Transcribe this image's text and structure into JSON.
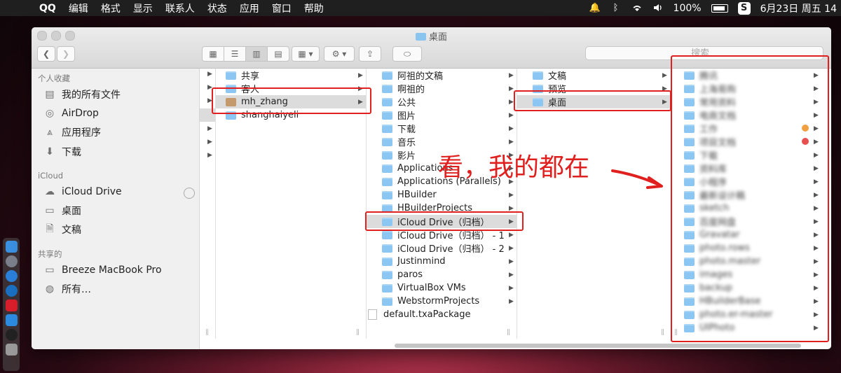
{
  "menubar": {
    "app_name": "QQ",
    "menus": [
      "编辑",
      "格式",
      "显示",
      "联系人",
      "状态",
      "应用",
      "窗口",
      "帮助"
    ],
    "battery": "100%",
    "datetime": "6月23日 周五  14",
    "status_icons": [
      "bell-icon",
      "bluetooth-icon",
      "wifi-icon",
      "volume-icon",
      "battery-icon",
      "sogou-input-icon"
    ]
  },
  "window": {
    "title": "桌面",
    "search_placeholder": "搜索"
  },
  "sidebar": {
    "favorites_header": "个人收藏",
    "favorites": [
      {
        "label": "我的所有文件",
        "icon": "all-files-icon"
      },
      {
        "label": "AirDrop",
        "icon": "airdrop-icon"
      },
      {
        "label": "应用程序",
        "icon": "applications-icon"
      },
      {
        "label": "下载",
        "icon": "download-icon"
      }
    ],
    "icloud_header": "iCloud",
    "icloud": [
      {
        "label": "iCloud Drive",
        "icon": "cloud-icon"
      },
      {
        "label": "桌面",
        "icon": "desktop-icon"
      },
      {
        "label": "文稿",
        "icon": "document-icon"
      }
    ],
    "shared_header": "共享的",
    "shared": [
      {
        "label": "Breeze MacBook Pro",
        "icon": "laptop-icon"
      },
      {
        "label": "所有…",
        "icon": "network-icon"
      }
    ]
  },
  "columns": {
    "col2": [
      "共享",
      "客人",
      "mh_zhang",
      "shanghaiyeli"
    ],
    "col3": [
      "阿祖的文稿",
      "啊祖的",
      "公共",
      "图片",
      "下载",
      "音乐",
      "影片",
      "Applications",
      "Applications (Parallels)",
      "HBuilder",
      "HBuilderProjects",
      "iCloud Drive（归档）",
      "iCloud Drive（归档） - 1",
      "iCloud Drive（归档） - 2",
      "Justinmind",
      "paros",
      "VirtualBox VMs",
      "WebstormProjects",
      "default.txaPackage"
    ],
    "col4": [
      "文稿",
      "预览",
      "桌面"
    ],
    "col5": [
      "腾讯",
      "上海易购",
      "常用资料",
      "电商文档",
      "工作",
      "项目文档",
      "下载",
      "资料库",
      "小程序",
      "最新设计稿",
      "sketch",
      "百度网盘",
      "Gravatar",
      "photo.rows",
      "photo.master",
      "images",
      "backup",
      "HBuilderBase",
      "photo.er-master",
      "UIPhoto"
    ]
  },
  "annotation": {
    "text": "看，我的都在"
  },
  "colors": {
    "annotation_red": "#e0201e",
    "folder_blue": "#8cc6f2",
    "tag_orange": "#f0a040",
    "tag_red": "#e85050"
  }
}
